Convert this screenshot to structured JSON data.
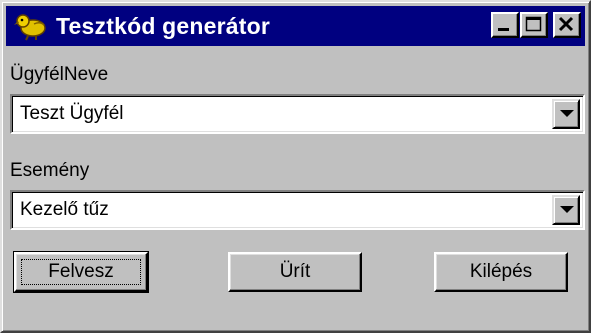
{
  "window": {
    "title": "Tesztkód generátor",
    "app_icon": "kiwi-bird-icon",
    "controls": [
      "minimize-icon",
      "maximize-icon",
      "close-icon"
    ]
  },
  "form": {
    "client_label": "ÜgyfélNeve",
    "client_value": "Teszt Ügyfél",
    "event_label": "Esemény",
    "event_value": "Kezelő tűz"
  },
  "buttons": {
    "add": "Felvesz",
    "clear": "Ürít",
    "exit": "Kilépés"
  },
  "colors": {
    "titlebar": "#000080",
    "face": "#c0c0c0"
  }
}
